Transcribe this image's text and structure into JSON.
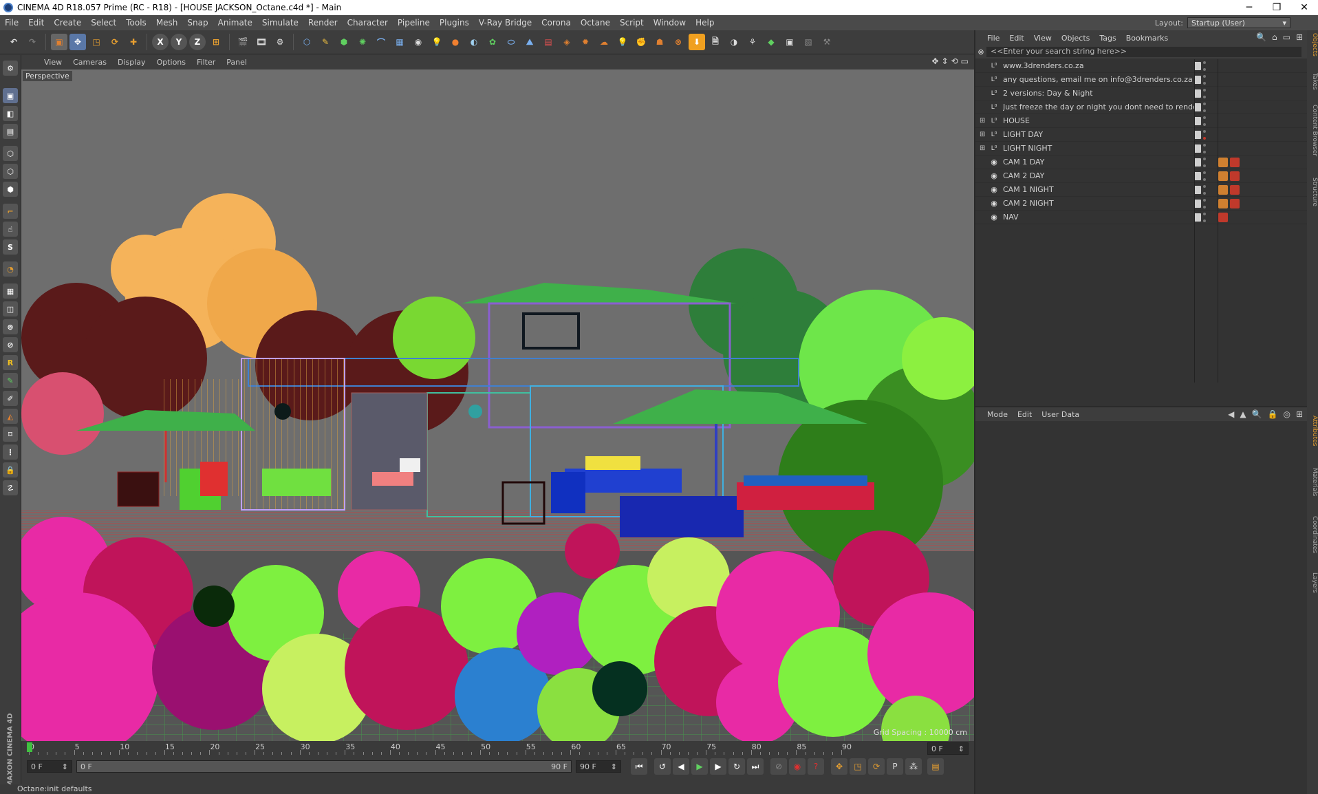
{
  "titlebar": {
    "title": "CINEMA 4D R18.057 Prime (RC - R18) - [HOUSE JACKSON_Octane.c4d *] - Main",
    "minimize": "─",
    "maximize": "❐",
    "close": "✕"
  },
  "menubar": {
    "items": [
      "File",
      "Edit",
      "Create",
      "Select",
      "Tools",
      "Mesh",
      "Snap",
      "Animate",
      "Simulate",
      "Render",
      "Character",
      "Pipeline",
      "Plugins",
      "V-Ray Bridge",
      "Corona",
      "Octane",
      "Script",
      "Window",
      "Help"
    ],
    "layout_label": "Layout:",
    "layout_value": "Startup (User)"
  },
  "toolbar": {
    "axis_x": "X",
    "axis_y": "Y",
    "axis_z": "Z"
  },
  "viewport": {
    "menu": [
      "View",
      "Cameras",
      "Display",
      "Options",
      "Filter",
      "Panel"
    ],
    "label": "Perspective",
    "grid_spacing": "Grid Spacing : 10000 cm"
  },
  "timeline": {
    "ticks": [
      "0",
      "5",
      "10",
      "15",
      "20",
      "25",
      "30",
      "35",
      "40",
      "45",
      "50",
      "55",
      "60",
      "65",
      "70",
      "75",
      "80",
      "85",
      "90"
    ],
    "current_frame": "0 F",
    "start_frame": "0 F",
    "range_start": "0 F",
    "range_end": "90 F",
    "end_frame": "90 F"
  },
  "status": {
    "text": "Octane:init defaults"
  },
  "brand": {
    "text": "MAXON CINEMA 4D"
  },
  "objects": {
    "menu": [
      "File",
      "Edit",
      "View",
      "Objects",
      "Tags",
      "Bookmarks"
    ],
    "search_placeholder": "<<Enter your search string here>>",
    "rows": [
      {
        "name": "www.3drenders.co.za",
        "type": "null",
        "expandable": false,
        "camera_tags": false
      },
      {
        "name": "any questions, email me on info@3drenders.co.za",
        "type": "null",
        "expandable": false,
        "camera_tags": false
      },
      {
        "name": "2 versions: Day & Night",
        "type": "null",
        "expandable": false,
        "camera_tags": false
      },
      {
        "name": "Just freeze the day or night you dont need to render",
        "type": "null",
        "expandable": false,
        "camera_tags": false
      },
      {
        "name": "HOUSE",
        "type": "null",
        "expandable": true,
        "camera_tags": false
      },
      {
        "name": "LIGHT DAY",
        "type": "null",
        "expandable": true,
        "camera_tags": false
      },
      {
        "name": "LIGHT NIGHT",
        "type": "null",
        "expandable": true,
        "camera_tags": false
      },
      {
        "name": "CAM 1 DAY",
        "type": "camera",
        "expandable": false,
        "camera_tags": true
      },
      {
        "name": "CAM 2 DAY",
        "type": "camera",
        "expandable": false,
        "camera_tags": true
      },
      {
        "name": "CAM 1 NIGHT",
        "type": "camera",
        "expandable": false,
        "camera_tags": true
      },
      {
        "name": "CAM 2 NIGHT",
        "type": "camera",
        "expandable": false,
        "camera_tags": true
      },
      {
        "name": "NAV",
        "type": "camera",
        "expandable": false,
        "camera_tags": "single"
      }
    ]
  },
  "attributes": {
    "menu": [
      "Mode",
      "Edit",
      "User Data"
    ]
  },
  "sidetabs": {
    "top": [
      "Objects",
      "Takes",
      "Content Browser",
      "Structure"
    ],
    "bottom": [
      "Attributes",
      "Materials",
      "Coordinates",
      "Layers"
    ]
  },
  "colors": {
    "panel": "#3a3a3a",
    "viewport_bg": "#6e6e6e",
    "accent_orange": "#e8a030",
    "tag_red": "#c0392b",
    "tag_orange": "#d08030"
  }
}
